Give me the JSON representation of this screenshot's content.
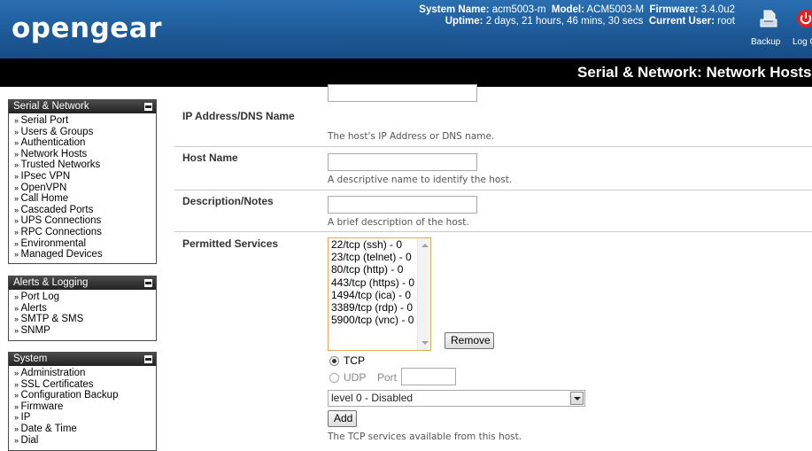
{
  "header": {
    "logo": "opengear",
    "system_name_label": "System Name:",
    "system_name": "acm5003-m",
    "model_label": "Model:",
    "model": "ACM5003-M",
    "firmware_label": "Firmware:",
    "firmware": "3.4.0u2",
    "uptime_label": "Uptime:",
    "uptime": "2 days, 21 hours, 46 mins, 30 secs",
    "current_user_label": "Current User:",
    "current_user": "root",
    "backup_label": "Backup",
    "logout_label": "Log Out"
  },
  "page": {
    "title": "Serial & Network: Network Hosts"
  },
  "sidebar": {
    "sections": [
      {
        "title": "Serial & Network",
        "items": [
          "Serial Port",
          "Users & Groups",
          "Authentication",
          "Network Hosts",
          "Trusted Networks",
          "IPsec VPN",
          "OpenVPN",
          "Call Home",
          "Cascaded Ports",
          "UPS Connections",
          "RPC Connections",
          "Environmental",
          "Managed Devices"
        ]
      },
      {
        "title": "Alerts & Logging",
        "items": [
          "Port Log",
          "Alerts",
          "SMTP & SMS",
          "SNMP"
        ]
      },
      {
        "title": "System",
        "items": [
          "Administration",
          "SSL Certificates",
          "Configuration Backup",
          "Firmware",
          "IP",
          "Date & Time",
          "Dial"
        ]
      }
    ]
  },
  "form": {
    "ip": {
      "label": "IP Address/DNS Name",
      "value": "",
      "hint": "The host's IP Address or DNS name."
    },
    "hostname": {
      "label": "Host Name",
      "value": "",
      "hint": "A descriptive name to identify the host."
    },
    "description": {
      "label": "Description/Notes",
      "value": "",
      "hint": "A brief description of the host."
    },
    "services": {
      "label": "Permitted Services",
      "options": [
        "22/tcp (ssh) - 0",
        "23/tcp (telnet) - 0",
        "80/tcp (http) - 0",
        "443/tcp (https) - 0",
        "1494/tcp (ica) - 0",
        "3389/tcp (rdp) - 0",
        "5900/tcp (vnc) - 0"
      ],
      "remove_label": "Remove",
      "tcp_label": "TCP",
      "udp_label": "UDP",
      "port_label": "Port",
      "port_value": "",
      "protocol_selected": "TCP",
      "level_selected": "level 0 - Disabled",
      "add_label": "Add",
      "hint": "The TCP services available from this host."
    }
  },
  "colors": {
    "header_blue": "#1e5a98",
    "titlebar": "#000000",
    "listbox_border": "#e0a95a"
  }
}
